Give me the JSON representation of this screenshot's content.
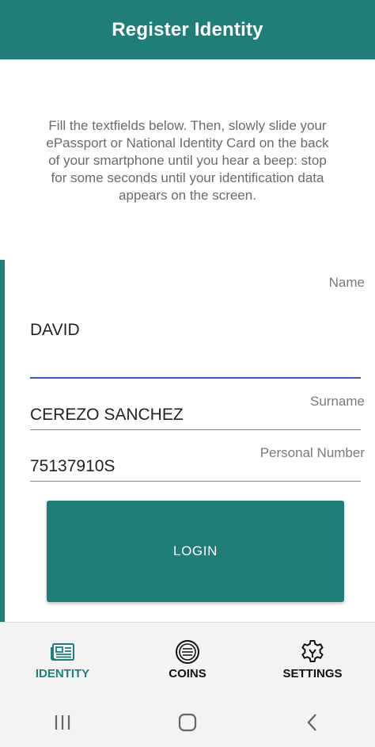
{
  "appbar": {
    "title": "Register Identity"
  },
  "instructions": "Fill the textfields below. Then, slowly slide your ePassport or National Identity Card on the back of your smartphone until you hear a beep: stop for some seconds until your identification data appears on the screen.",
  "form": {
    "name": {
      "label": "Name",
      "value": "DAVID"
    },
    "surname": {
      "label": "Surname",
      "value": "CEREZO SANCHEZ"
    },
    "personal_number": {
      "label": "Personal Number",
      "value": "75137910S"
    },
    "login_label": "LOGIN"
  },
  "bottom_nav": {
    "items": [
      {
        "label": "IDENTITY",
        "icon": "newspaper-icon",
        "active": true
      },
      {
        "label": "COINS",
        "icon": "coin-icon",
        "active": false
      },
      {
        "label": "SETTINGS",
        "icon": "gear-icon",
        "active": false
      }
    ]
  },
  "colors": {
    "primary": "#1f7f78",
    "focus_underline": "#3f51b5"
  }
}
